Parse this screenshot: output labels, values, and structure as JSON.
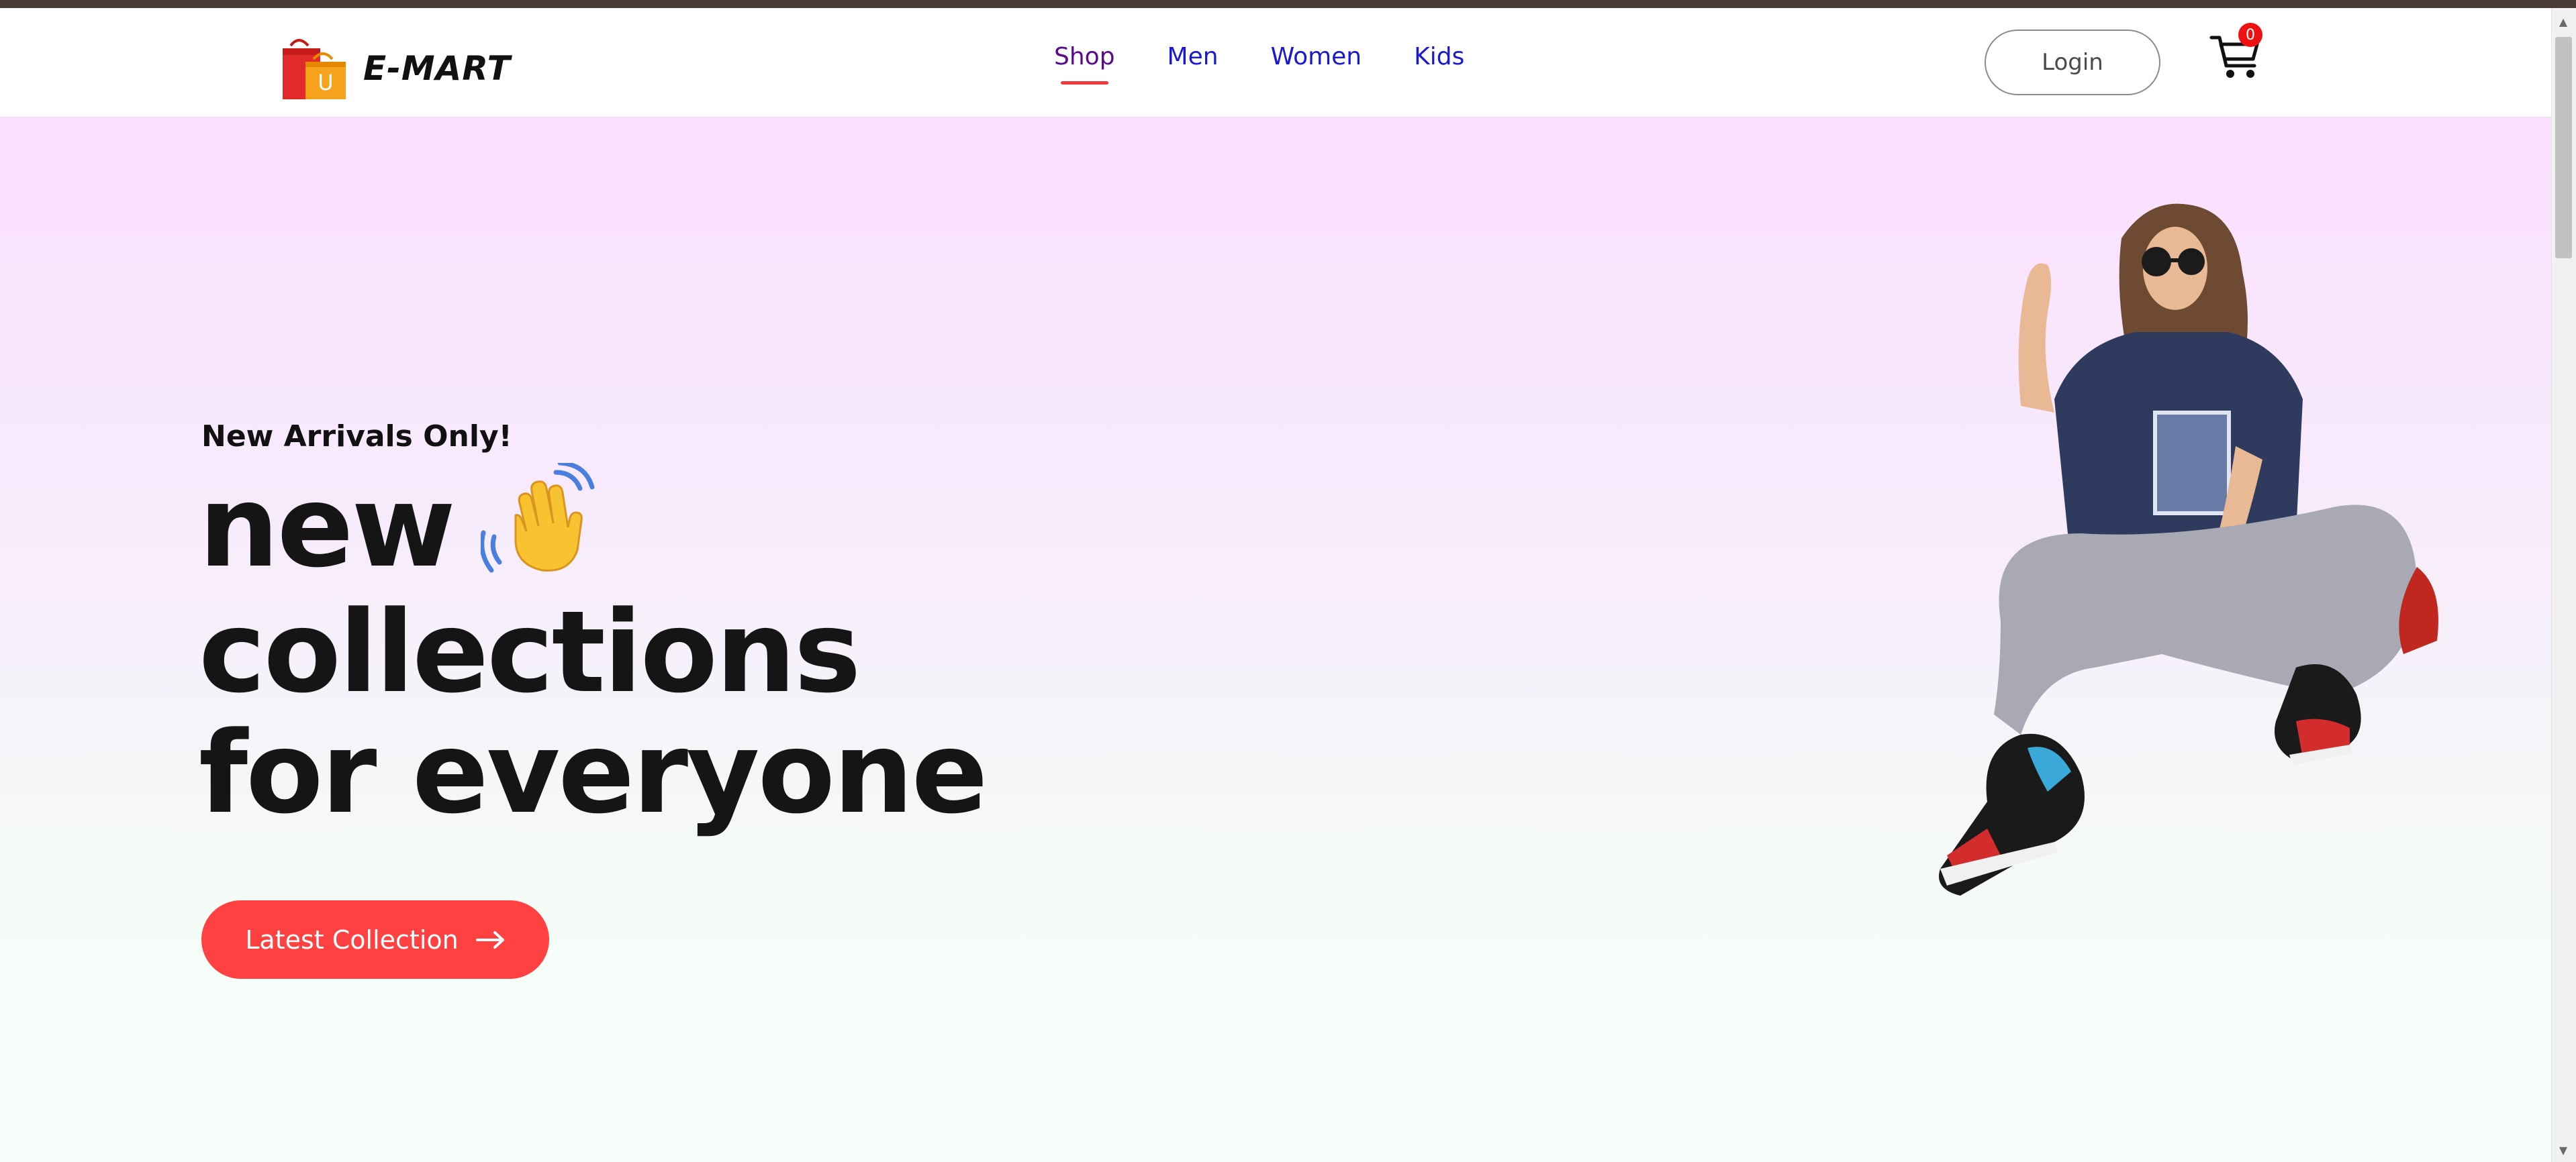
{
  "brand": {
    "name": "E-MART",
    "logo_letter": "U"
  },
  "nav": {
    "items": [
      {
        "label": "Shop",
        "active": true
      },
      {
        "label": "Men",
        "active": false
      },
      {
        "label": "Women",
        "active": false
      },
      {
        "label": "Kids",
        "active": false
      }
    ]
  },
  "header": {
    "login_label": "Login",
    "cart_count": "0"
  },
  "hero": {
    "eyebrow": "New Arrivals Only!",
    "title_line1": "new",
    "title_line2": "collections",
    "title_line3": "for everyone",
    "cta_label": "Latest Collection"
  },
  "colors": {
    "accent": "#ff4141",
    "nav_link": "#1919d2",
    "nav_active": "#5a0a8c",
    "hero_gradient_top": "#fbdfff",
    "hero_gradient_bottom": "#f7fdf9"
  },
  "icons": {
    "logo": "shopping-bags-icon",
    "cart": "cart-icon",
    "wave": "waving-hand-icon",
    "cta": "arrow-right-icon"
  }
}
